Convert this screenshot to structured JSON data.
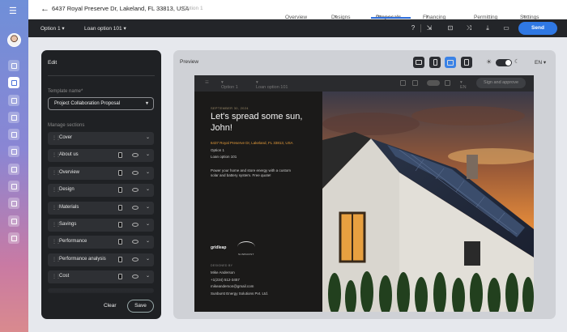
{
  "header": {
    "address": "6437 Royal Preserve Dr, Lakeland, FL 33813, USA",
    "option_label": "Option 1",
    "tabs": [
      {
        "label": "Overview",
        "chevron": false
      },
      {
        "label": "Designs",
        "chevron": true
      },
      {
        "label": "Proposals",
        "chevron": true,
        "active": true
      },
      {
        "label": "Financing",
        "chevron": true
      },
      {
        "label": "Permitting",
        "chevron": false
      },
      {
        "label": "Settings",
        "chevron": true
      }
    ]
  },
  "toolbar": {
    "option_select": "Option 1",
    "loan_select": "Loan option 101",
    "send_label": "Send",
    "icons": [
      "help-icon",
      "export-icon",
      "embed-icon",
      "shuffle-icon",
      "download-icon",
      "present-icon"
    ]
  },
  "edit_panel": {
    "title": "Edit",
    "template_label": "Template name*",
    "template_value": "Project Collaboration Proposal",
    "sections_label": "Manage sections",
    "sections": [
      "Cover",
      "About us",
      "Overview",
      "Design",
      "Materials",
      "Savings",
      "Performance",
      "Performance analysis",
      "Cost"
    ],
    "clear_label": "Clear",
    "save_label": "Save"
  },
  "preview": {
    "title": "Preview",
    "language": "EN",
    "document": {
      "toolbar": {
        "option": "Option 1",
        "loan": "Loan option 101",
        "lang": "EN",
        "sign_button": "Sign and approve"
      },
      "date": "SEPTEMBER 30, 2024",
      "headline": "Let's spread some sun, John!",
      "address": "6437 Royal Preserve Dr, Lakeland, FL 33813, USA",
      "option": "Option 1",
      "loan": "Loan option 101",
      "tagline": "Power your home and store energy with a custom solar and battery system. Free quote!",
      "logo_text": "gridleap",
      "logo2_text": "SUNBURST",
      "designed_by_label": "DESIGNED BY",
      "designer_name": "Mike Anderson",
      "designer_phone": "+1(234) 512-3457",
      "designer_email": "mikeanderson@gmail.com",
      "company": "Sunburst Energy Solutions Pvt. Ltd."
    }
  },
  "colors": {
    "accent": "#2f78e4",
    "dark_panel": "#1f2124",
    "address_orange": "#e49b3a"
  }
}
